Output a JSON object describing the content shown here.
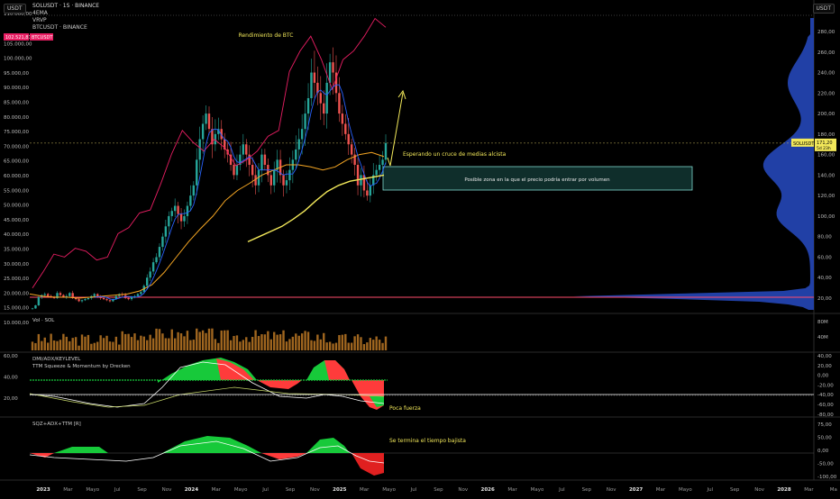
{
  "header": {
    "symbol_title": "SOLUSDT · 1S · BINANCE",
    "indicator_ma": "4EMA",
    "indicator_vrvp": "VRVP",
    "overlay_symbol": "BTCUSDT · BINANCE",
    "currency_left": "USDT",
    "currency_right": "USDT"
  },
  "price_tags": {
    "btc_price": "102.521,81",
    "btc_label": "BTCUSDT",
    "sol_label": "SOLUSDT",
    "sol_price": "171,20",
    "sol_countdown": "5d 23h"
  },
  "annotations": {
    "btc_perf": "Rendimiento de BTC",
    "cross": "Esperando un cruce de medias alcista",
    "zone": "Posible zona en la que el precio podría entrar por volumen",
    "weak": "Poca fuerza",
    "bear_end": "Se termina el tiempo bajista"
  },
  "panels": {
    "volume_label": "Vol · SOL",
    "dmi_label": "DMI/ADX/KEYLEVEL",
    "ttm_label": "TTM Squeeze & Momentum by Drecken",
    "sqz_label": "SQZ+ADX+TTM [R]"
  },
  "colors": {
    "up": "#26a69a",
    "down": "#ef5350",
    "btc_line": "#e91e63",
    "ema_orange": "#f5a623",
    "ema_blue": "#2962ff",
    "annotation_yellow": "#f2e85a",
    "vrvp": "#2547b8",
    "zone_fill": "#0f2e2b",
    "zone_border": "#7fd9cf",
    "key_level": "#ff4d6d",
    "volume_bar": "#a0661f"
  },
  "chart_data": [
    {
      "type": "candlestick",
      "title": "SOLUSDT · 1S · BINANCE",
      "x_labels": [
        "2023",
        "Mar",
        "Mayo",
        "Jul",
        "Sep",
        "Nov",
        "2024",
        "Mar",
        "Mayo",
        "Jul",
        "Sep",
        "Nov",
        "2025",
        "Mar",
        "Mayo",
        "Jul",
        "Sep",
        "Nov",
        "2026",
        "Mar",
        "Mayo",
        "Jul",
        "Sep",
        "Nov",
        "2027",
        "Mar",
        "Mayo",
        "Jul",
        "Sep",
        "Nov",
        "2028",
        "Mar",
        "Ma"
      ],
      "right_axis_ticks": [
        "280,00",
        "260,00",
        "240,00",
        "220,00",
        "200,00",
        "180,00",
        "160,00",
        "140,00",
        "120,00",
        "100,00",
        "80,00",
        "60,00",
        "40,00",
        "20,00"
      ],
      "left_axis_ticks": [
        "110.000,00",
        "105.000,00",
        "100.000,00",
        "95.000,00",
        "90.000,00",
        "85.000,00",
        "80.000,00",
        "75.000,00",
        "70.000,00",
        "65.000,00",
        "60.000,00",
        "55.000,00",
        "50.000,00",
        "45.000,00",
        "40.000,00",
        "35.000,00",
        "30.000,00",
        "25.000,00",
        "20.000,00",
        "15.000,00",
        "10.000,00"
      ],
      "sol_weekly_close_approx": [
        10,
        13,
        21,
        23,
        24,
        22,
        21,
        20,
        25,
        23,
        21,
        22,
        25,
        20,
        19,
        17,
        18,
        19,
        20,
        22,
        24,
        22,
        20,
        19,
        18,
        17,
        19,
        22,
        24,
        23,
        20,
        19,
        21,
        22,
        24,
        26,
        32,
        40,
        46,
        55,
        60,
        70,
        80,
        90,
        100,
        105,
        110,
        102,
        95,
        100,
        110,
        120,
        130,
        155,
        175,
        190,
        200,
        185,
        170,
        180,
        185,
        175,
        165,
        160,
        150,
        140,
        150,
        160,
        170,
        160,
        150,
        140,
        130,
        145,
        160,
        150,
        140,
        130,
        145,
        155,
        140,
        130,
        135,
        145,
        155,
        165,
        175,
        185,
        200,
        215,
        240,
        230,
        220,
        210,
        200,
        230,
        250,
        240,
        220,
        200,
        190,
        180,
        170,
        160,
        150,
        130,
        140,
        125,
        120,
        130,
        140,
        145,
        150,
        155,
        171.2
      ],
      "btc_overlay_approx": [
        16500,
        22000,
        28000,
        27000,
        30000,
        29000,
        26000,
        27000,
        35000,
        37000,
        42000,
        43000,
        52000,
        62000,
        70000,
        66000,
        63000,
        67000,
        64000,
        58000,
        60000,
        63000,
        68000,
        70000,
        90000,
        97000,
        102000,
        94000,
        84000,
        94000,
        97000,
        102000,
        108000,
        105000
      ],
      "ema_orange_approx": [
        24,
        22,
        21,
        21,
        20,
        21,
        22,
        23,
        24,
        27,
        33,
        45,
        60,
        75,
        88,
        100,
        115,
        125,
        132,
        140,
        145,
        150,
        150,
        148,
        145,
        148,
        155,
        160,
        162,
        158
      ],
      "ema_yellow_approx": [
        75,
        80,
        85,
        90,
        97,
        105,
        115,
        124,
        130,
        134,
        136,
        138,
        140
      ],
      "current_price": 171.2,
      "btc_current": 102521.81
    },
    {
      "type": "bar",
      "title": "Vol · SOL",
      "y_ticks": [
        "80M",
        "40M"
      ]
    },
    {
      "type": "area",
      "title": "DMI/ADX/KEYLEVEL",
      "left_ticks": [
        "60,00",
        "40,00",
        "20,00"
      ],
      "right_ticks": [
        "40,00",
        "20,00",
        "0,00",
        "-20,00",
        "-40,00",
        "-60,00",
        "-80,00"
      ]
    },
    {
      "type": "area",
      "title": "SQZ+ADX+TTM [R]",
      "right_ticks": [
        "75,00",
        "50,00",
        "0,00",
        "-50,00",
        "-100,00"
      ]
    }
  ]
}
